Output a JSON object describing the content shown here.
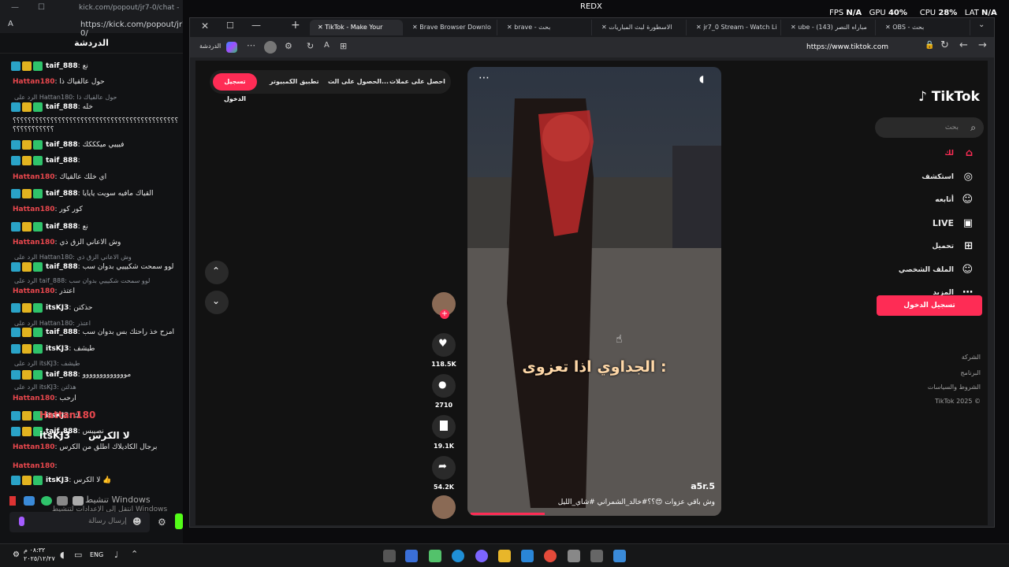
{
  "kick_window": {
    "title_url": "kick.com/popout/jr7-0/chat -",
    "addr_url": "https://kick.com/popout/jr7-0/",
    "chat_title": "الدردشة",
    "input_placeholder": "إرسال رسالة",
    "messages": [
      {
        "user": "taif_888",
        "text": "نع"
      },
      {
        "user": "Hattan180",
        "text": "حول عالقياك ذا"
      },
      {
        "reply": "الرد على Hattan180: حول عالقياك ذا"
      },
      {
        "user": "taif_888",
        "text": "خله"
      },
      {
        "text": "؟؟؟؟؟؟؟؟؟؟؟؟؟؟؟؟؟؟؟؟؟؟؟؟؟؟؟؟؟؟؟؟؟؟؟؟؟؟؟؟؟؟؟؟؟؟؟؟؟؟؟؟"
      },
      {
        "text": "؟؟؟؟؟؟؟؟؟؟؟"
      },
      {
        "user": "taif_888",
        "text": "فيييي ميكككك"
      },
      {
        "user": "taif_888",
        "text": ""
      },
      {
        "user": "Hattan180",
        "text": "اي خلك عالقياك"
      },
      {
        "user": "taif_888",
        "text": "القياك مافيه سويت يايايا"
      },
      {
        "user": "Hattan180",
        "text": "كور كور"
      },
      {
        "user": "taif_888",
        "text": "نع"
      },
      {
        "user": "Hattan180",
        "text": "وش الاعاني الزق ذي"
      },
      {
        "reply": "الرد على Hattan180: وش الاعاني الزق ذي"
      },
      {
        "user": "taif_888",
        "text": "لوو سمحت شكيييي بدوان سب"
      },
      {
        "reply": "الرد على taif_888: لوو سمحت شكيييي بدوان سب"
      },
      {
        "user": "Hattan180",
        "text": "اعتذر"
      },
      {
        "user": "itsKJ3",
        "text": "حذكتن"
      },
      {
        "reply": "الرد على Hattan180: اعتذر"
      },
      {
        "user": "taif_888",
        "text": "امزح خذ راحتك بس بدوان سب"
      },
      {
        "user": "itsKJ3",
        "text": "طيشف"
      },
      {
        "reply": "الرد على itsKJ3: طيشف"
      },
      {
        "user": "taif_888",
        "text": "مووووووووووووو"
      },
      {
        "reply": "الرد على itsKJ3: هذلتن"
      },
      {
        "user": "Hattan180",
        "text": "ارحب"
      },
      {
        "user": "itsKJ3",
        "text": "ك"
      },
      {
        "user": "taif_888",
        "text": "نصيبس"
      },
      {
        "user": "Hattan180",
        "text": "برجال الكاديلاك اطلق من الكرس"
      },
      {
        "user": "Hattan180",
        "text": ""
      },
      {
        "user": "itsKJ3",
        "text": "لا الكرس 👍"
      }
    ],
    "overlay_user1": "Hattan180",
    "overlay_user2": "itsKJ3",
    "overlay_text": "لا الكرس",
    "watermark": "تنشيط Windows",
    "watermark2": "انتقل إلى الإعدادات لتنشيط Windows"
  },
  "overlay": {
    "redx": "REDX",
    "fps_label": "FPS",
    "fps_value": "N/A",
    "gpu_label": "GPU",
    "gpu_value": "40%",
    "cpu_label": "CPU",
    "cpu_value": "28%",
    "lat_label": "LAT",
    "lat_value": "N/A"
  },
  "browser": {
    "tabs": [
      {
        "label": "TikTok - Make Your",
        "active": true
      },
      {
        "label": "Brave Browser Downlo"
      },
      {
        "label": "brave - بحث"
      },
      {
        "label": "الاسطورة لبث المباريات"
      },
      {
        "label": "jr7_0 Stream - Watch Li"
      },
      {
        "label": "ube - (143) مباراه النصر"
      },
      {
        "label": "OBS - بحث"
      }
    ],
    "url": "https://www.tiktok.com",
    "sidebar_label": "الدردشة"
  },
  "tiktok": {
    "top_login": "تسجيل الدخول",
    "top_items": [
      "تطبيق الكمبيوتر",
      "الحصول على الت...",
      "احصل على عملات"
    ],
    "video_caption_big": "الجداوي اذا تعزوى :",
    "author": "a5r.5",
    "description": "وش باقي عزوات 😍؟؟#خالد_الشمراني #شاي_الليل",
    "likes": "118.5K",
    "comments": "2710",
    "saves": "19.1K",
    "shares": "54.2K",
    "progress_fraction": 0.3,
    "logo": "TikTok",
    "search_placeholder": "بحث",
    "nav": [
      {
        "label": "لك",
        "icon": "home-icon",
        "active": true
      },
      {
        "label": "استكشف",
        "icon": "compass-icon"
      },
      {
        "label": "أتابعه",
        "icon": "following-icon"
      },
      {
        "label": "LIVE",
        "icon": "live-icon",
        "live": true
      },
      {
        "label": "تحميل",
        "icon": "upload-icon"
      },
      {
        "label": "الملف الشخصي",
        "icon": "profile-icon"
      },
      {
        "label": "المزيد",
        "icon": "more-icon"
      }
    ],
    "login_button": "تسجيل الدخول",
    "footer": [
      "الشركة",
      "البرنامج",
      "الشروط والسياسات",
      "TikTok 2025 ©"
    ]
  },
  "taskbar": {
    "time": "٠٨:٣٢ م",
    "date": "٢٠٢٥/١٢/٢٧",
    "lang": "ENG"
  },
  "colors": {
    "tiktok_red": "#fe2c55",
    "kick_green": "#53fc18",
    "hattan_red": "#e8474d"
  }
}
